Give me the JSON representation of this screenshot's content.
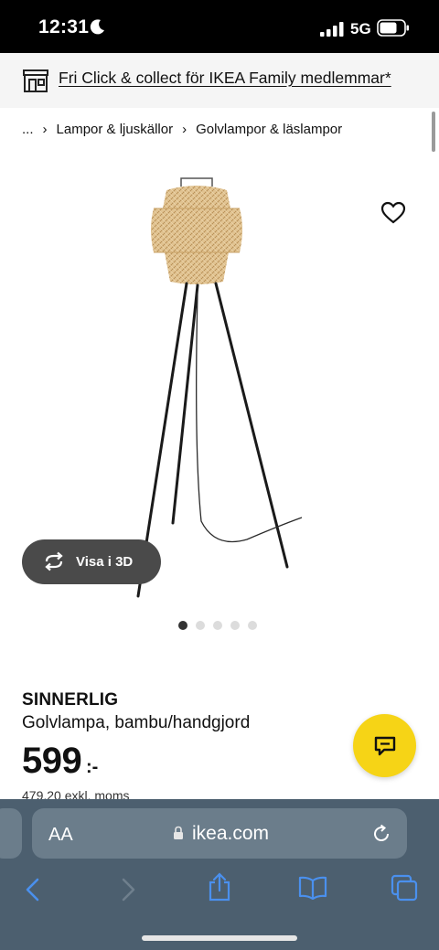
{
  "status_bar": {
    "time": "12:31",
    "network": "5G"
  },
  "promo": {
    "text": "Fri Click & collect för IKEA Family medlemmar*",
    "icon": "store-icon"
  },
  "breadcrumb": {
    "items": [
      "...",
      "Lampor & ljuskällor",
      "Golvlampor & läslampor"
    ]
  },
  "product": {
    "name": "SINNERLIG",
    "description": "Golvlampa, bambu/handgjord",
    "price": "599",
    "price_suffix": ":-",
    "price_ex_vat": "479,20 exkl. moms",
    "image_count": 5,
    "active_image": 0
  },
  "view3d": {
    "label": "Visa i 3D"
  },
  "browser": {
    "text_size_label": "AA",
    "url": "ikea.com"
  },
  "colors": {
    "chat_button": "#f6d416",
    "safari_bar": "#4c5f6f",
    "view3d_button": "#4a4a4a"
  }
}
